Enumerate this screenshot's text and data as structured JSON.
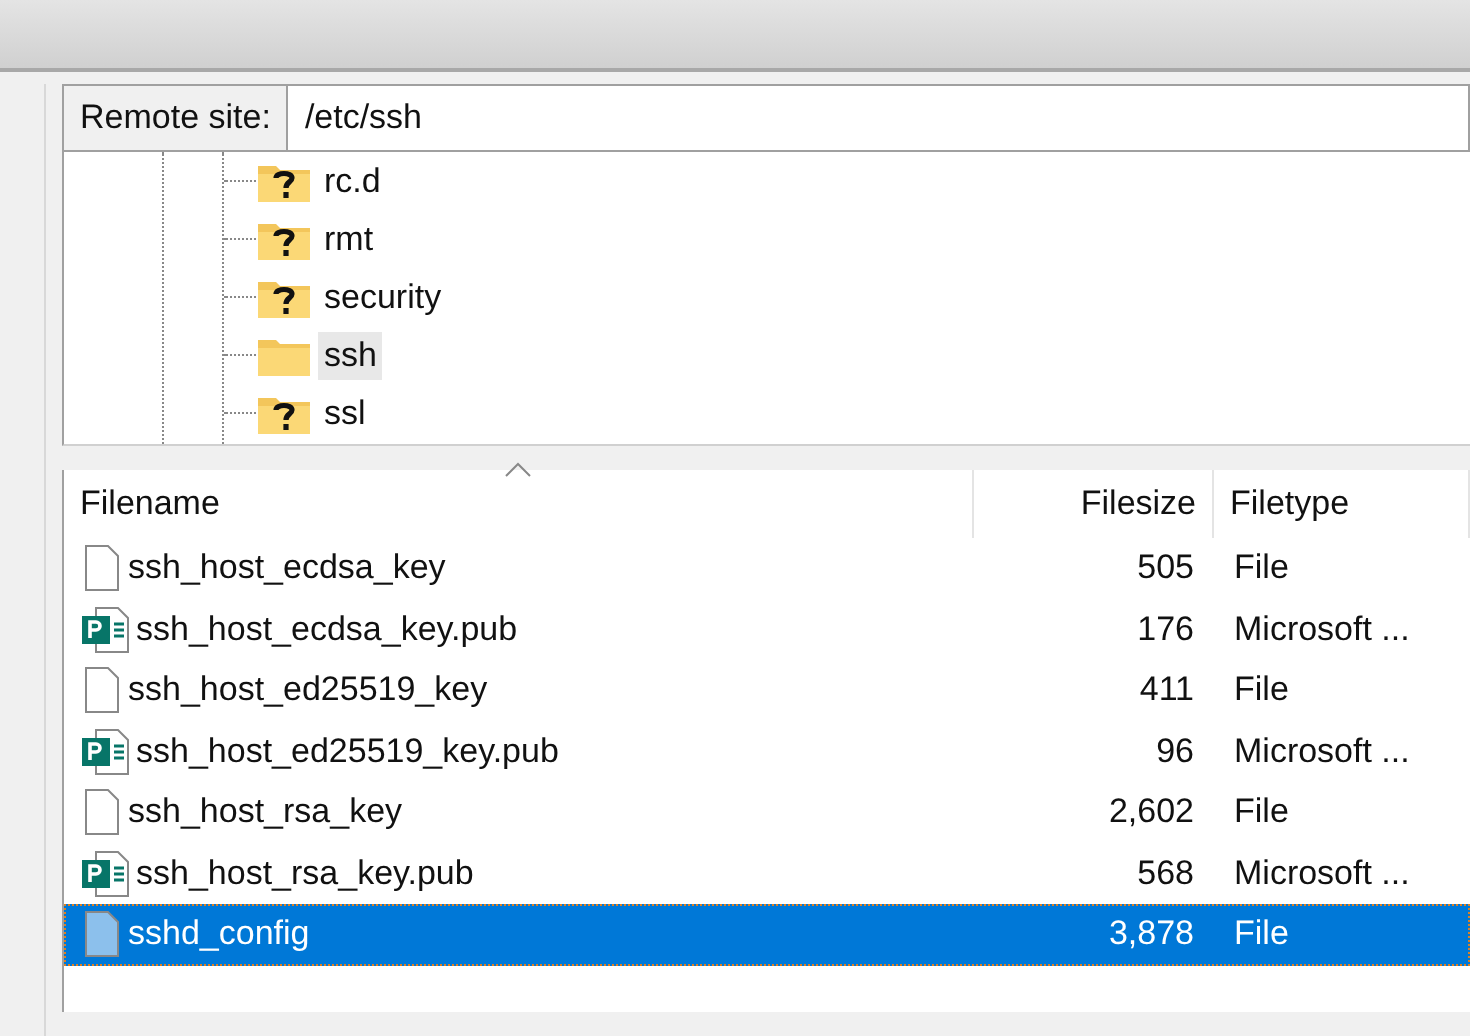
{
  "remote_site": {
    "label": "Remote site:",
    "path": "/etc/ssh"
  },
  "tree": [
    {
      "name": "rc.d",
      "kind": "unknown",
      "selected": false
    },
    {
      "name": "rmt",
      "kind": "unknown",
      "selected": false
    },
    {
      "name": "security",
      "kind": "unknown",
      "selected": false
    },
    {
      "name": "ssh",
      "kind": "folder",
      "selected": true
    },
    {
      "name": "ssl",
      "kind": "unknown",
      "selected": false
    }
  ],
  "file_list": {
    "columns": [
      "Filename",
      "Filesize",
      "Filetype"
    ],
    "rows": [
      {
        "name": "ssh_host_ecdsa_key",
        "size": "505",
        "type": "File",
        "kind": "file",
        "selected": false
      },
      {
        "name": "ssh_host_ecdsa_key.pub",
        "size": "176",
        "type": "Microsoft ...",
        "kind": "publisher",
        "selected": false
      },
      {
        "name": "ssh_host_ed25519_key",
        "size": "411",
        "type": "File",
        "kind": "file",
        "selected": false
      },
      {
        "name": "ssh_host_ed25519_key.pub",
        "size": "96",
        "type": "Microsoft ...",
        "kind": "publisher",
        "selected": false
      },
      {
        "name": "ssh_host_rsa_key",
        "size": "2,602",
        "type": "File",
        "kind": "file",
        "selected": false
      },
      {
        "name": "ssh_host_rsa_key.pub",
        "size": "568",
        "type": "Microsoft ...",
        "kind": "publisher",
        "selected": false
      },
      {
        "name": "sshd_config",
        "size": "3,878",
        "type": "File",
        "kind": "file",
        "selected": true
      }
    ]
  }
}
